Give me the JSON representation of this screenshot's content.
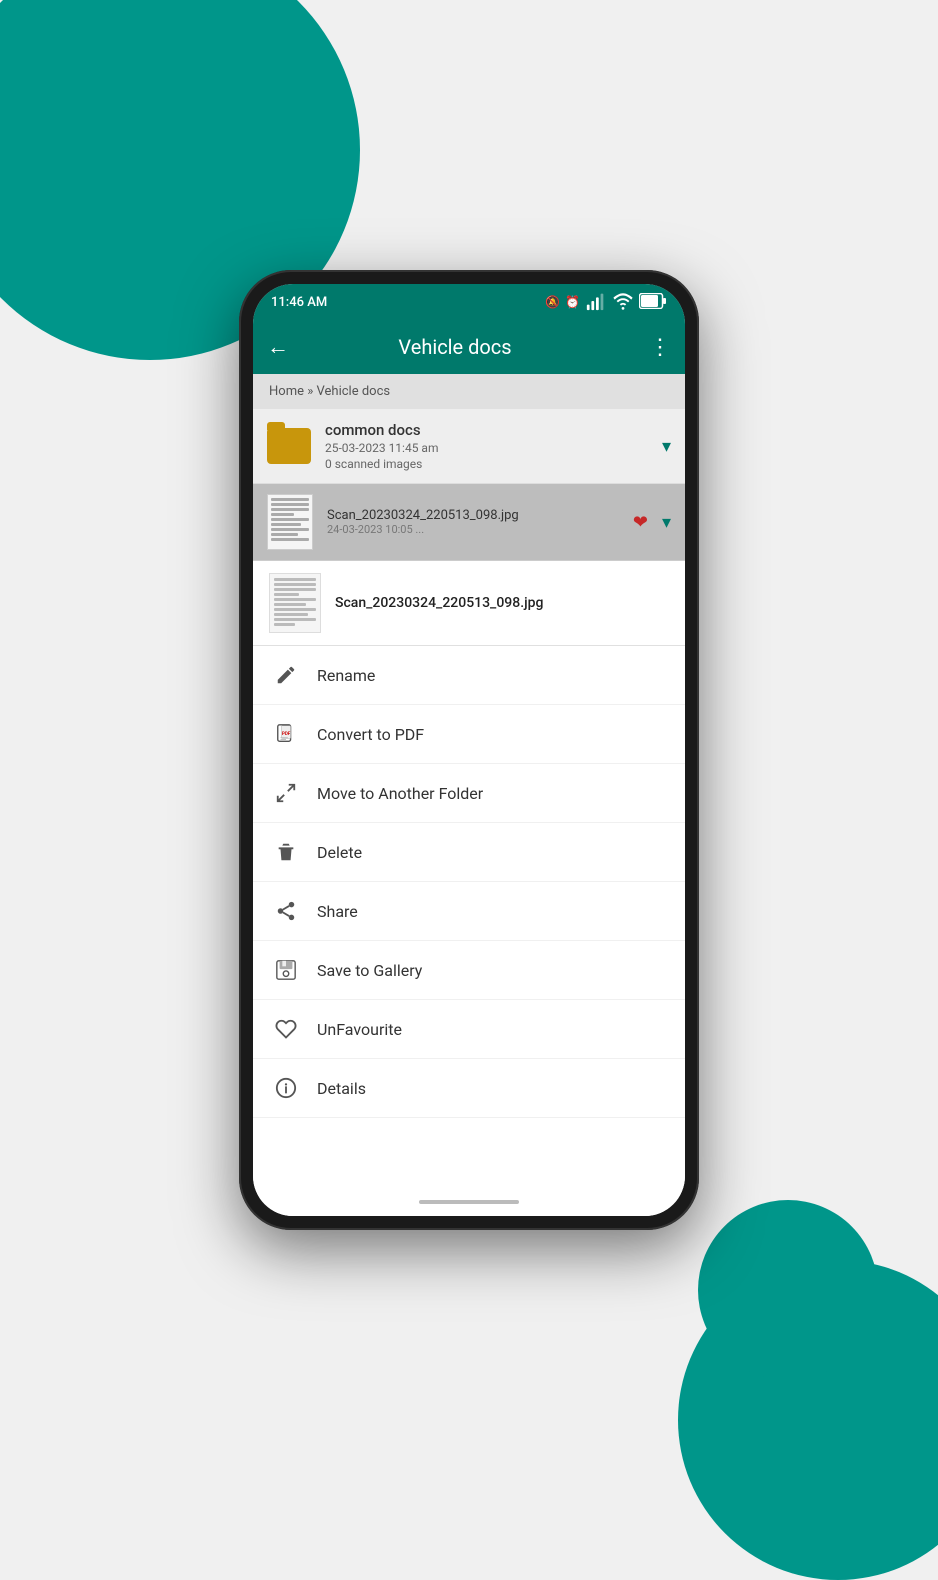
{
  "background": {
    "color1": "#00968A",
    "color2": "#00968A"
  },
  "status_bar": {
    "time": "11:46 AM",
    "icons": "📵 ⏰ $"
  },
  "app_bar": {
    "title": "Vehicle docs",
    "back_label": "←",
    "menu_label": "⋮"
  },
  "breadcrumb": {
    "text": "Home » Vehicle docs"
  },
  "folder_item": {
    "name": "common docs",
    "date": "25-03-2023 11:45 am",
    "count": "0 scanned images"
  },
  "scan_item": {
    "name": "Scan_20230324_220513_098.jpg",
    "date": "24-03-2023 10:05 ..."
  },
  "context_menu": {
    "filename": "Scan_20230324_220513_098.jpg",
    "items": [
      {
        "id": "rename",
        "label": "Rename",
        "icon": "pencil"
      },
      {
        "id": "convert-pdf",
        "label": "Convert to PDF",
        "icon": "pdf"
      },
      {
        "id": "move-folder",
        "label": "Move to Another Folder",
        "icon": "move"
      },
      {
        "id": "delete",
        "label": "Delete",
        "icon": "trash"
      },
      {
        "id": "share",
        "label": "Share",
        "icon": "share"
      },
      {
        "id": "save-gallery",
        "label": "Save to Gallery",
        "icon": "save"
      },
      {
        "id": "unfavourite",
        "label": "UnFavourite",
        "icon": "heart"
      },
      {
        "id": "details",
        "label": "Details",
        "icon": "info"
      }
    ]
  }
}
